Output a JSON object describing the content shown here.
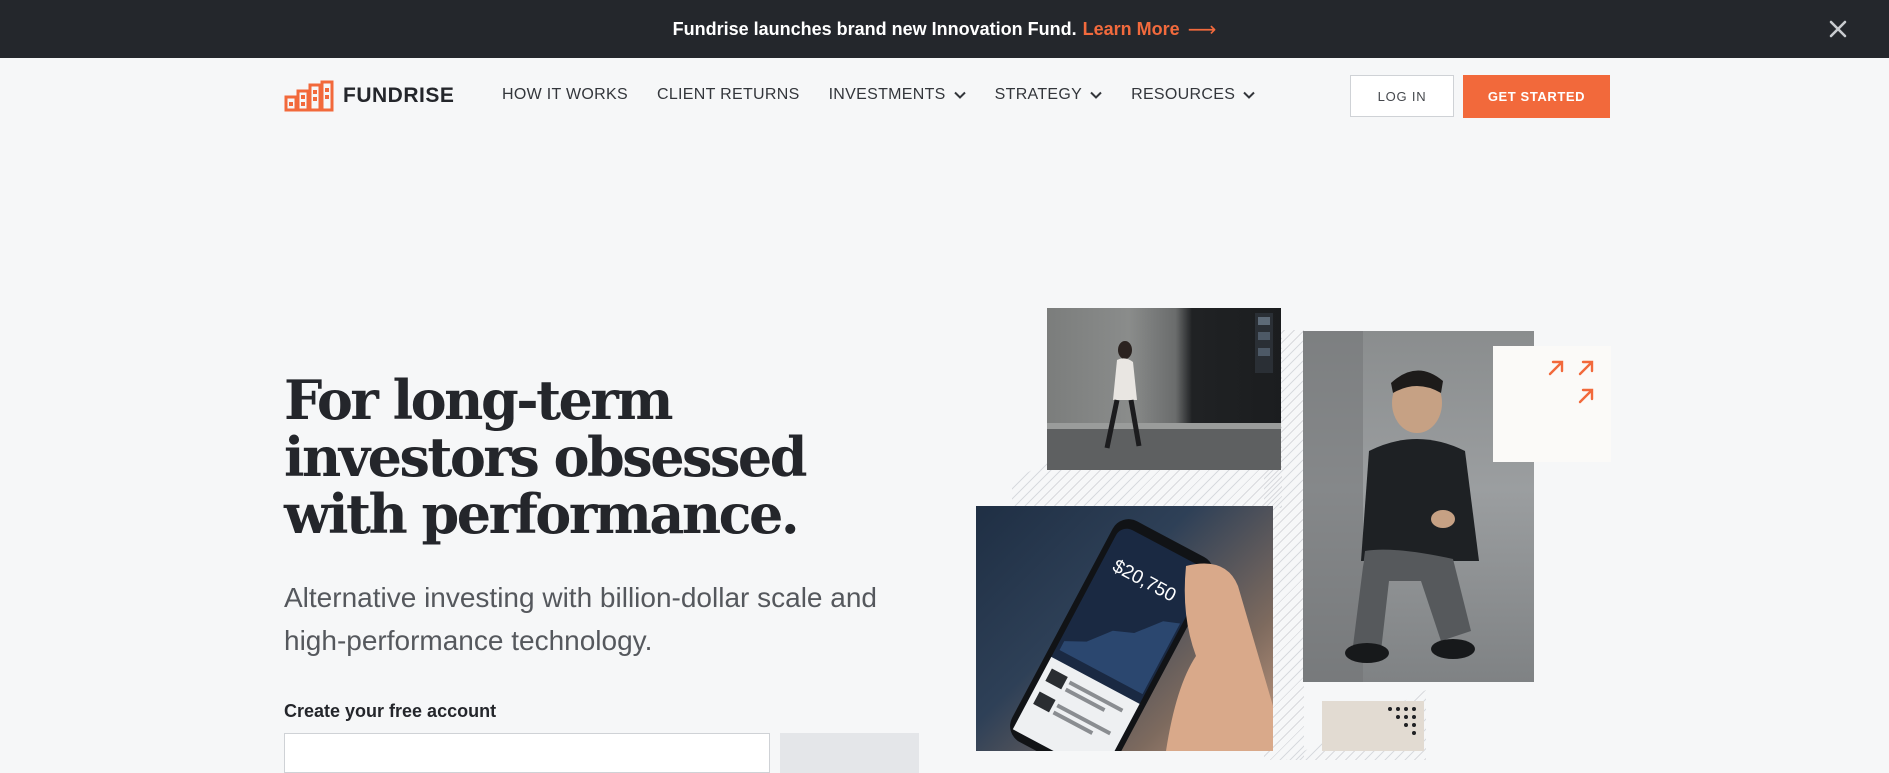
{
  "banner": {
    "text": "Fundrise launches brand new Innovation Fund.",
    "link": "Learn More",
    "arrow": "⟶",
    "close_icon": "close-icon"
  },
  "nav": {
    "logo_text": "FUNDRISE",
    "links": [
      {
        "label": "HOW IT WORKS",
        "dropdown": false
      },
      {
        "label": "CLIENT RETURNS",
        "dropdown": false
      },
      {
        "label": "INVESTMENTS",
        "dropdown": true
      },
      {
        "label": "STRATEGY",
        "dropdown": true
      },
      {
        "label": "RESOURCES",
        "dropdown": true
      }
    ],
    "login": "LOG IN",
    "get_started": "GET STARTED"
  },
  "hero": {
    "headline": "For long-term investors obsessed with performance.",
    "subhead": "Alternative investing with billion-dollar scale and high-performance technology.",
    "form_label": "Create your free account",
    "email_placeholder": ""
  },
  "phone": {
    "balance": "$20,750"
  },
  "colors": {
    "accent": "#f2693b",
    "banner_bg": "#24272c",
    "page_bg": "#f6f7f8"
  }
}
